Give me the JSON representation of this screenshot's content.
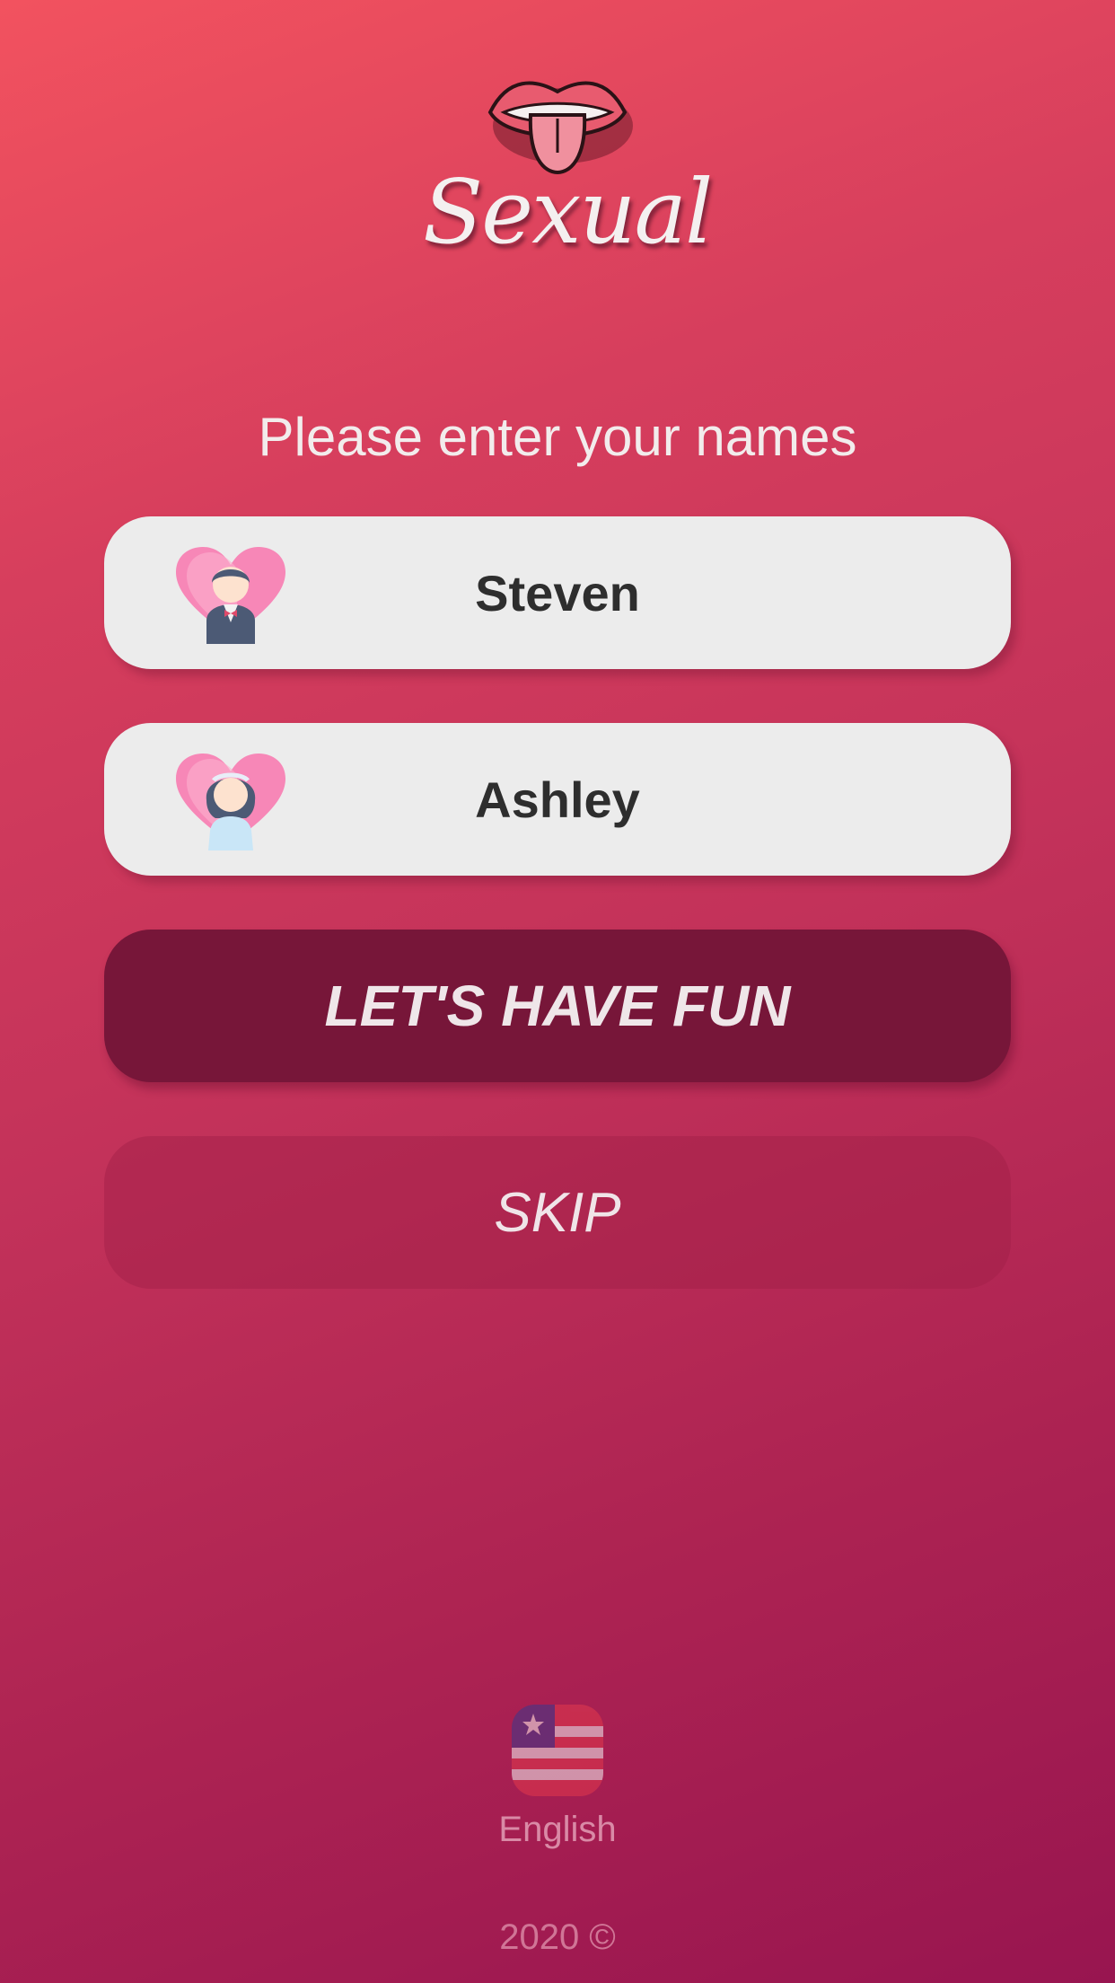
{
  "app": {
    "logo_text": "Sexual",
    "logo_icon": "lips-tongue-icon"
  },
  "prompt": "Please enter your names",
  "players": [
    {
      "name": "Steven",
      "avatar": "groom-heart-icon"
    },
    {
      "name": "Ashley",
      "avatar": "bride-heart-icon"
    }
  ],
  "buttons": {
    "primary_label": "LET'S HAVE FUN",
    "skip_label": "SKIP"
  },
  "language": {
    "label": "English",
    "flag_icon": "us-flag-icon"
  },
  "footer": "2020 ©",
  "colors": {
    "accent_dark": "#771639",
    "pill_bg": "#ececec"
  }
}
